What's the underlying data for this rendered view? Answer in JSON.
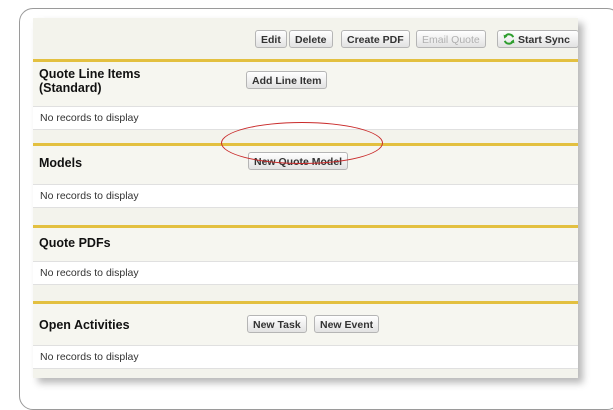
{
  "toolbar": {
    "edit": "Edit",
    "delete": "Delete",
    "create_pdf": "Create PDF",
    "email_quote": "Email Quote",
    "start_sync": "Start Sync"
  },
  "sections": {
    "line_items": {
      "title": "Quote Line Items (Standard)",
      "button": "Add Line Item",
      "empty": "No records to display"
    },
    "models": {
      "title": "Models",
      "button": "New Quote Model",
      "empty": "No records to display"
    },
    "pdfs": {
      "title": "Quote PDFs",
      "empty": "No records to display"
    },
    "activities": {
      "title": "Open Activities",
      "new_task": "New Task",
      "new_event": "New Event",
      "empty": "No records to display"
    }
  },
  "colors": {
    "section_accent": "#e3c040",
    "highlight_circle": "#c92a2a",
    "sync_icon": "#2e9e2e"
  },
  "icons": {
    "sync": "sync-icon"
  }
}
